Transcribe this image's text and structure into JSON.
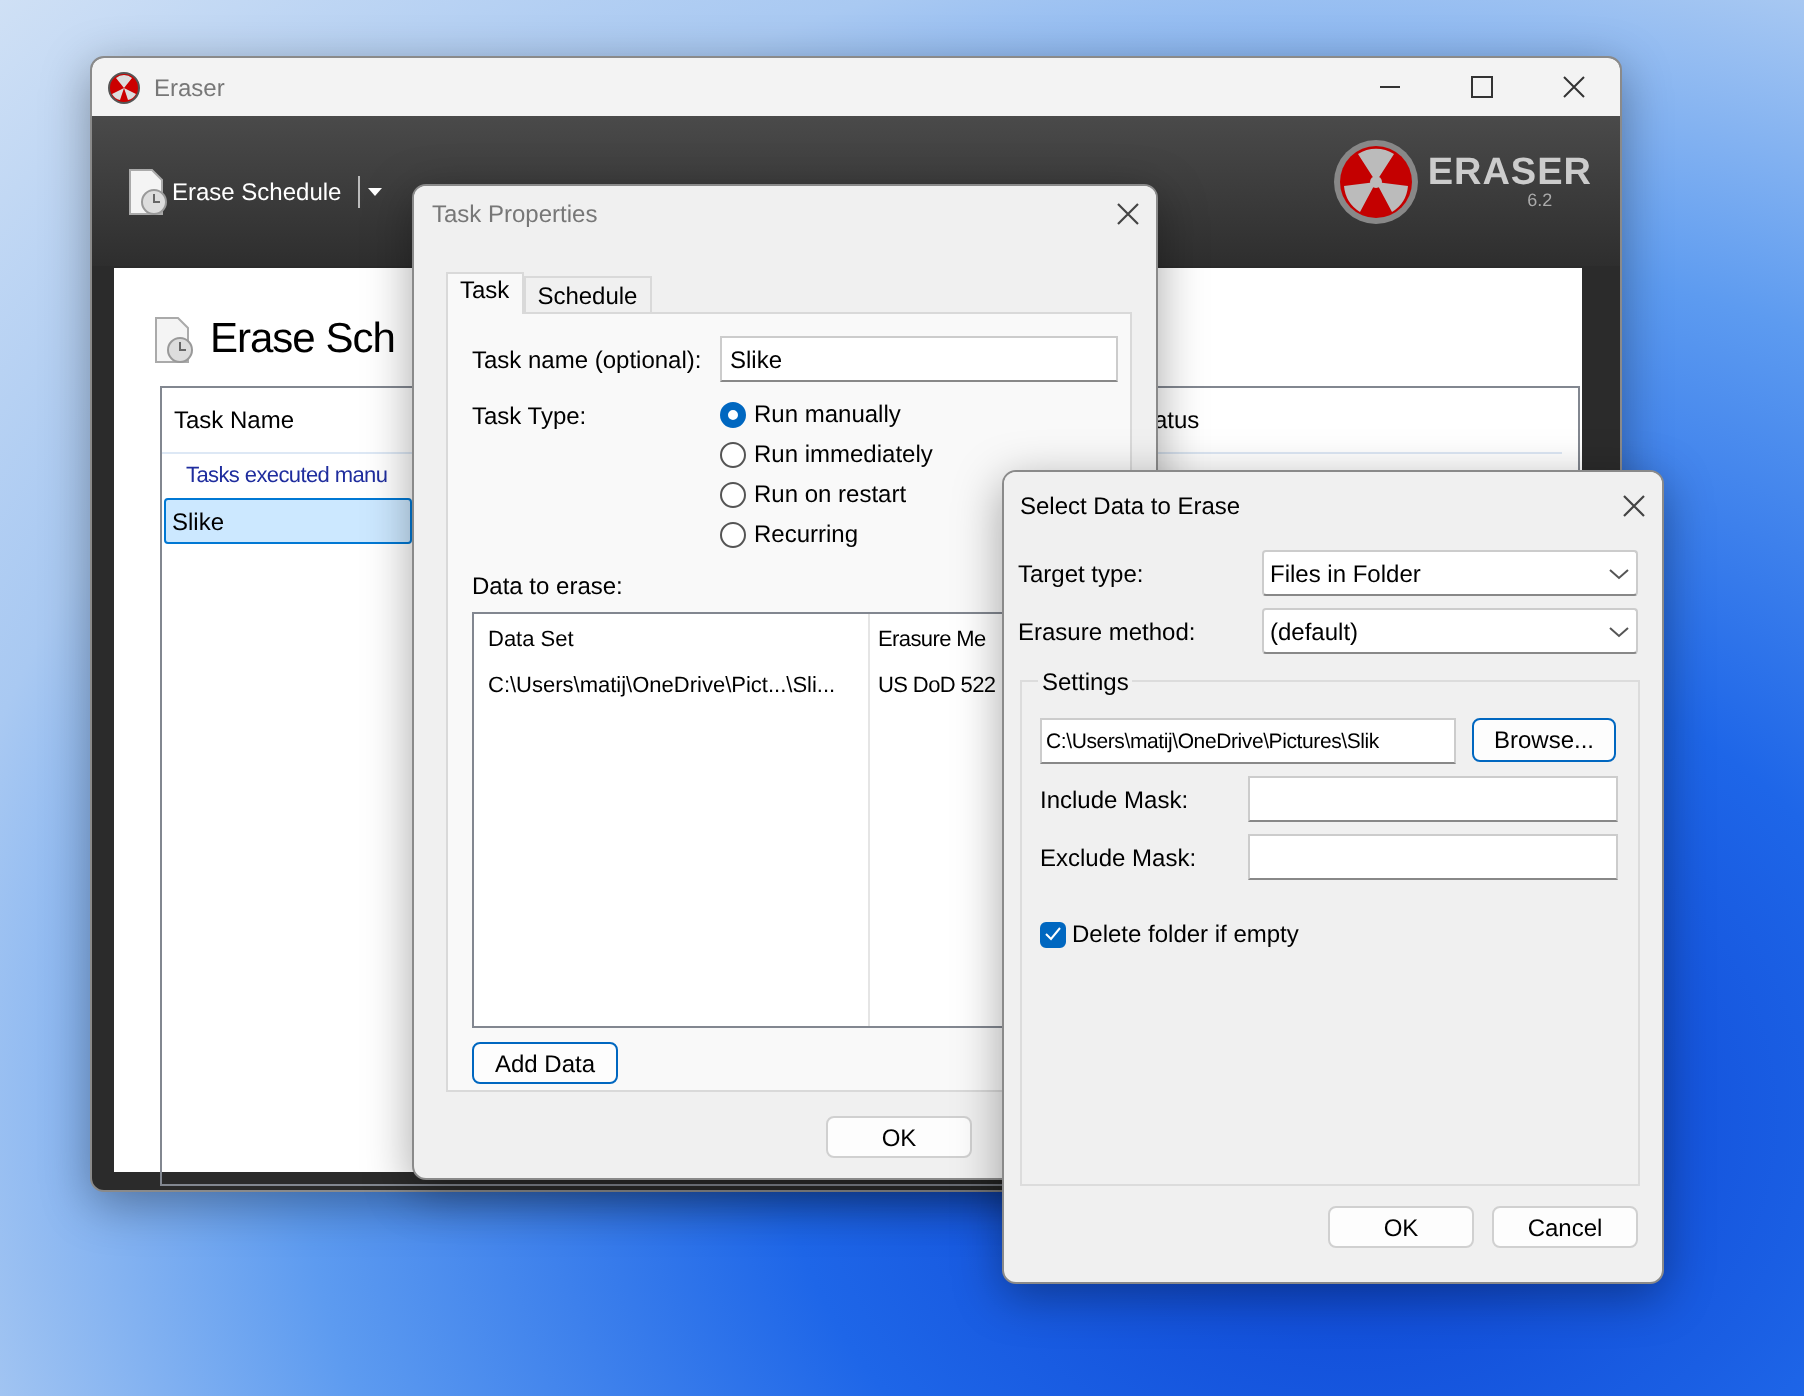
{
  "main_window": {
    "title": "Eraser",
    "toolbar": {
      "schedule_button": "Erase Schedule"
    },
    "logo": {
      "name": "ERASER",
      "version": "6.2"
    },
    "heading": "Erase Sch",
    "table": {
      "columns": [
        "Task Name",
        "atus"
      ],
      "rows": [
        {
          "kind": "group",
          "text": "Tasks executed manu",
          "selected": false
        },
        {
          "kind": "task",
          "text": "Slike",
          "selected": true
        }
      ]
    }
  },
  "task_properties": {
    "title": "Task Properties",
    "tabs": [
      {
        "label": "Task",
        "selected": true
      },
      {
        "label": "Schedule",
        "selected": false
      }
    ],
    "task_name_label": "Task name (optional):",
    "task_name": "Slike",
    "task_type_label": "Task Type:",
    "task_types": [
      {
        "label": "Run manually",
        "selected": true
      },
      {
        "label": "Run immediately",
        "selected": false
      },
      {
        "label": "Run on restart",
        "selected": false
      },
      {
        "label": "Recurring",
        "selected": false
      }
    ],
    "data_label": "Data to erase:",
    "data_table": {
      "columns": [
        "Data Set",
        "Erasure Me"
      ],
      "rows": [
        [
          "C:\\Users\\matij\\OneDrive\\Pict...\\Sli...",
          "US DoD 522"
        ]
      ]
    },
    "add_button": "Add Data",
    "buttons": [
      "OK"
    ]
  },
  "select_data": {
    "title": "Select Data to Erase",
    "target_type_label": "Target type:",
    "target_type": "Files in Folder",
    "method_label": "Erasure method:",
    "method": "(default)",
    "settings": {
      "legend": "Settings",
      "path": "C:\\Users\\matij\\OneDrive\\Pictures\\Slik",
      "browse_button": "Browse...",
      "include_label": "Include Mask:",
      "exclude_label": "Exclude Mask:",
      "delete_if_empty": {
        "label": "Delete folder if empty",
        "checked": true
      }
    },
    "buttons": [
      "OK",
      "Cancel"
    ]
  }
}
